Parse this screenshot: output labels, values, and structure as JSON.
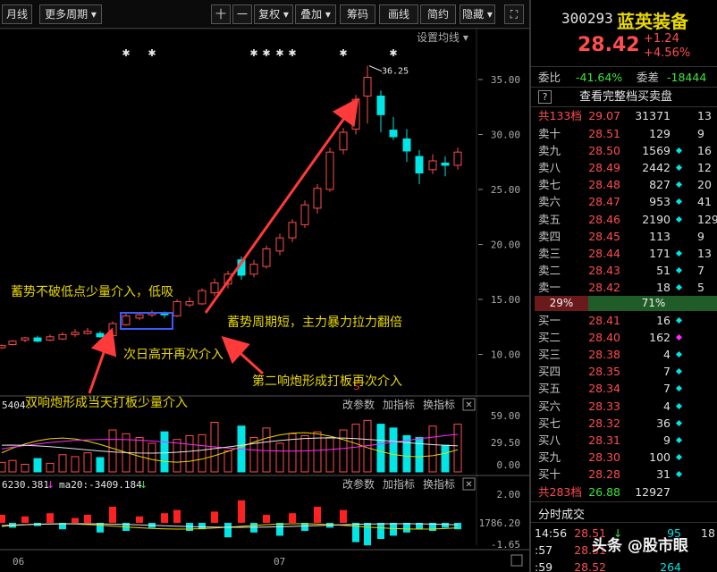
{
  "toolbar": {
    "buttons": [
      "月线",
      "更多周期",
      "十",
      "一",
      "复权",
      "叠加",
      "筹码",
      "画线",
      "简约",
      "隐藏"
    ],
    "has_dropdown": [
      false,
      true,
      false,
      false,
      true,
      true,
      false,
      false,
      false,
      true
    ]
  },
  "main_chart": {
    "ma_setting_label": "设置均线",
    "y_ticks": [
      "35.00",
      "30.00",
      "25.00",
      "20.00",
      "15.00",
      "10.00"
    ],
    "high_label": "36.25",
    "signal_marks": [
      "✱",
      "✱",
      "✱",
      "✱",
      "✱",
      "✱",
      "✱",
      "✱"
    ],
    "s_marker": "S",
    "annotations": {
      "a1": "蓄势不破低点少量介入，低吸",
      "a2": "次日高开再次介入",
      "a3": "蓄势周期短，主力暴力拉力翻倍",
      "a4": "第二响炮形成打板再次介入",
      "a5": "双响炮形成当天打板少量介入"
    }
  },
  "volume_pane": {
    "left_value": "5404.",
    "buttons": [
      "改参数",
      "加指标",
      "换指标"
    ],
    "close_icon": "✕",
    "y_ticks": [
      "59.00",
      "29.50",
      "0.00"
    ]
  },
  "macd_pane": {
    "left_value": "6230.381",
    "ma_label": "ma20:-3409.184",
    "buttons": [
      "改参数",
      "加指标",
      "换指标"
    ],
    "close_icon": "✕",
    "y_ticks": [
      "2.00",
      "1786.20",
      "-1.65"
    ]
  },
  "x_labels": [
    "06",
    "07"
  ],
  "quote": {
    "code": "300293",
    "name": "蓝英装备",
    "price": "28.42",
    "change": "+1.24",
    "change_pct": "+4.56%",
    "weibi_label": "委比",
    "weibi_value": "-41.64%",
    "weicha_label": "委差",
    "weicha_value": "-18444",
    "full_depth_label": "查看完整档买卖盘",
    "help_icon": "?",
    "sell_total": {
      "label": "共133档",
      "price": "29.07",
      "vol": "31371",
      "ext": "13"
    },
    "asks": [
      {
        "label": "卖十",
        "price": "28.51",
        "vol": "129",
        "ext": "9"
      },
      {
        "label": "卖九",
        "price": "28.50",
        "vol": "1569",
        "ext": "16"
      },
      {
        "label": "卖八",
        "price": "28.49",
        "vol": "2442",
        "ext": "12"
      },
      {
        "label": "卖七",
        "price": "28.48",
        "vol": "827",
        "ext": "20"
      },
      {
        "label": "卖六",
        "price": "28.47",
        "vol": "953",
        "ext": "41"
      },
      {
        "label": "卖五",
        "price": "28.46",
        "vol": "2190",
        "ext": "129"
      },
      {
        "label": "卖四",
        "price": "28.45",
        "vol": "113",
        "ext": "9"
      },
      {
        "label": "卖三",
        "price": "28.44",
        "vol": "171",
        "ext": "13"
      },
      {
        "label": "卖二",
        "price": "28.43",
        "vol": "51",
        "ext": "7"
      },
      {
        "label": "卖一",
        "price": "28.42",
        "vol": "18",
        "ext": "5"
      }
    ],
    "ask_dots": [
      false,
      true,
      true,
      true,
      true,
      true,
      false,
      true,
      true,
      true
    ],
    "ratio_left": "29%",
    "ratio_right": "71%",
    "bids": [
      {
        "label": "买一",
        "price": "28.41",
        "vol": "16",
        "ext": ""
      },
      {
        "label": "买二",
        "price": "28.40",
        "vol": "162",
        "ext": ""
      },
      {
        "label": "买三",
        "price": "28.38",
        "vol": "4",
        "ext": ""
      },
      {
        "label": "买四",
        "price": "28.35",
        "vol": "7",
        "ext": ""
      },
      {
        "label": "买五",
        "price": "28.34",
        "vol": "7",
        "ext": ""
      },
      {
        "label": "买六",
        "price": "28.33",
        "vol": "4",
        "ext": ""
      },
      {
        "label": "买七",
        "price": "28.32",
        "vol": "36",
        "ext": ""
      },
      {
        "label": "买八",
        "price": "28.31",
        "vol": "9",
        "ext": ""
      },
      {
        "label": "买九",
        "price": "28.30",
        "vol": "100",
        "ext": ""
      },
      {
        "label": "买十",
        "price": "28.28",
        "vol": "31",
        "ext": ""
      }
    ],
    "bid_dots": [
      "#00e5e5",
      "#ff2bff",
      "#00e5e5",
      "#00e5e5",
      "#00e5e5",
      "#00e5e5",
      "#00e5e5",
      "#00e5e5",
      "#00e5e5",
      "#00e5e5"
    ],
    "buy_total": {
      "label": "共283档",
      "price": "26.88",
      "vol": "12927"
    },
    "ticks_title": "分时成交",
    "ticks": [
      {
        "time": "14:56",
        "price": "28.51",
        "arrow": "↓",
        "vol": "95",
        "ext": "18"
      },
      {
        "time": ":57",
        "price": "28.51",
        "arrow": "",
        "vol": "",
        "ext": ""
      },
      {
        "time": ":59",
        "price": "28.52",
        "arrow": "",
        "vol": "264",
        "ext": ""
      }
    ],
    "watermark": "头条 @股市眼"
  },
  "colors": {
    "up": "#ff4d4d",
    "down": "#00e5e5",
    "annotation": "#e8d700",
    "arrow": "#ff3a3a"
  }
}
